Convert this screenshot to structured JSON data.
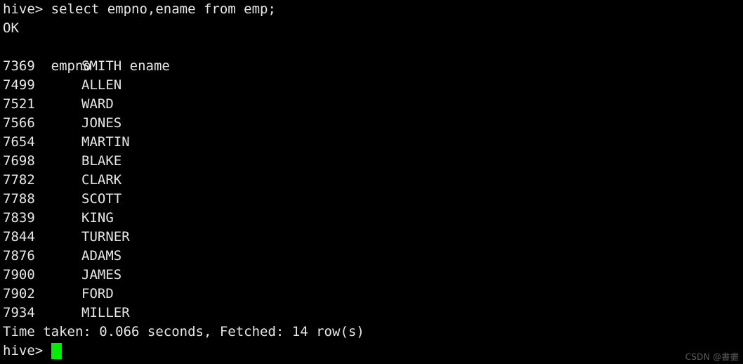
{
  "terminal": {
    "background_color": "#000000",
    "text_color": "#e6e6e6",
    "cursor_color": "#00ef00",
    "command_line": "hive> select empno,ename from emp;",
    "status_ok": "OK",
    "header": {
      "empno": "empno",
      "ename": "ename"
    },
    "rows": [
      {
        "empno": "7369",
        "ename": "SMITH"
      },
      {
        "empno": "7499",
        "ename": "ALLEN"
      },
      {
        "empno": "7521",
        "ename": "WARD"
      },
      {
        "empno": "7566",
        "ename": "JONES"
      },
      {
        "empno": "7654",
        "ename": "MARTIN"
      },
      {
        "empno": "7698",
        "ename": "BLAKE"
      },
      {
        "empno": "7782",
        "ename": "CLARK"
      },
      {
        "empno": "7788",
        "ename": "SCOTT"
      },
      {
        "empno": "7839",
        "ename": "KING"
      },
      {
        "empno": "7844",
        "ename": "TURNER"
      },
      {
        "empno": "7876",
        "ename": "ADAMS"
      },
      {
        "empno": "7900",
        "ename": "JAMES"
      },
      {
        "empno": "7902",
        "ename": "FORD"
      },
      {
        "empno": "7934",
        "ename": "MILLER"
      }
    ],
    "summary": "Time taken: 0.066 seconds, Fetched: 14 row(s)",
    "prompt": "hive> "
  },
  "watermark": {
    "text": "CSDN @書盡"
  }
}
